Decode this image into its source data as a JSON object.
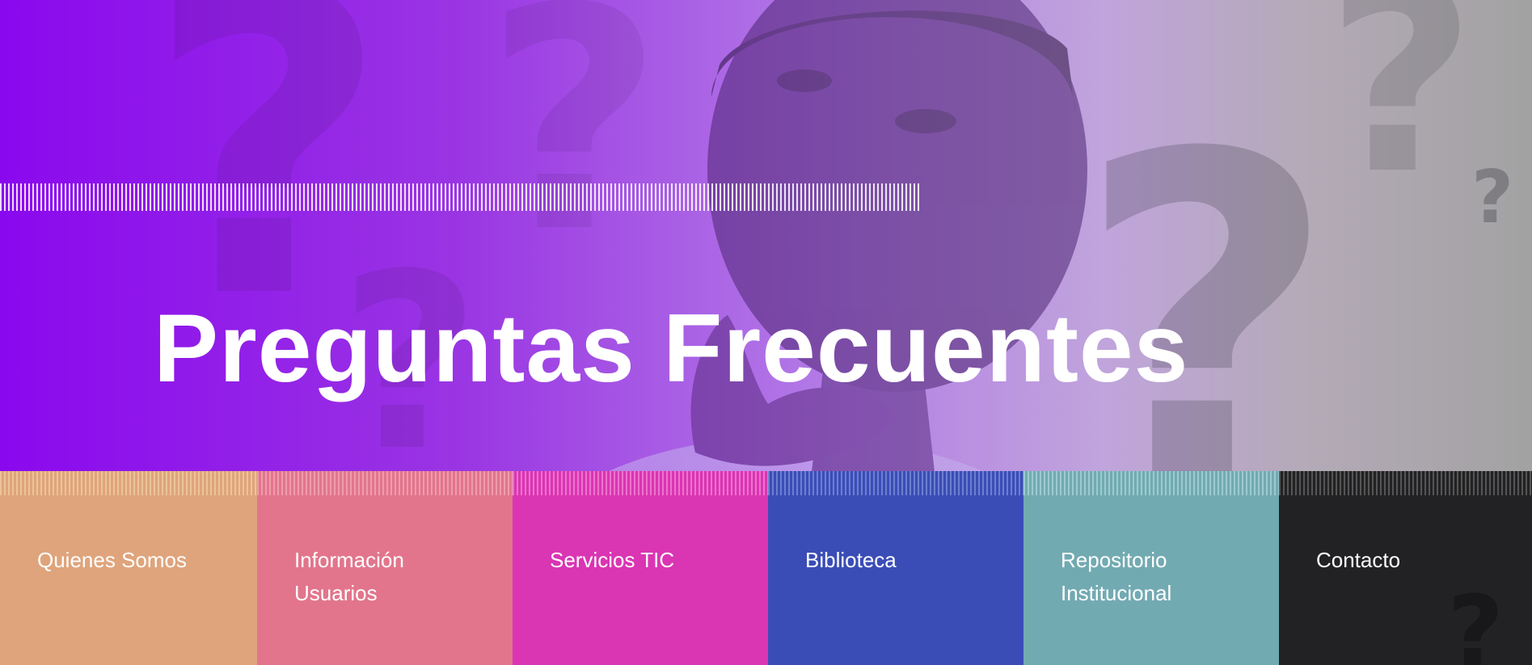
{
  "hero": {
    "title": "Preguntas Frecuentes",
    "gradient_colors": [
      "#8a08ee",
      "#b47ee6",
      "#a2a2a2"
    ],
    "image": "thinking-person"
  },
  "tiles": [
    {
      "label": "Quienes Somos",
      "color": "#dfa47b",
      "stripe": "#ebc49a"
    },
    {
      "label": "Información Usuarios",
      "color": "#e2758c",
      "stripe": "#ee9cad"
    },
    {
      "label": "Servicios TIC",
      "color": "#da35b3",
      "stripe": "#ec73cc"
    },
    {
      "label": "Biblioteca",
      "color": "#3a4db6",
      "stripe": "#6d7fcf"
    },
    {
      "label": "Repositorio Institucional",
      "color": "#72aab2",
      "stripe": "#9ccbd0"
    },
    {
      "label": "Contacto",
      "color": "#222224",
      "stripe": "#555555"
    }
  ],
  "decorations": {
    "icon": "question-mark-icon"
  }
}
